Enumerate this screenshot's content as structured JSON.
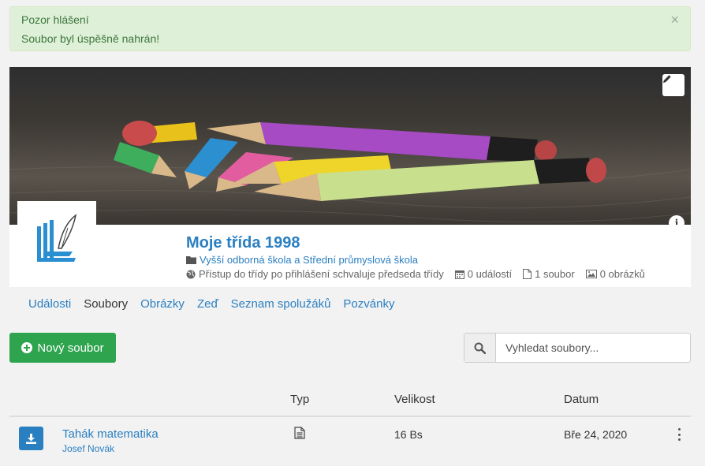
{
  "alert": {
    "title": "Pozor hlášení",
    "message": "Soubor byl úspěšně nahrán!",
    "close": "×"
  },
  "class": {
    "title": "Moje třída 1998",
    "school": "Vyšší odborná škola a Střední průmyslová škola",
    "access": "Přístup do třídy po přihlášení schvaluje předseda třídy",
    "events_count": "0 událostí",
    "files_count": "1 soubor",
    "images_count": "0 obrázků"
  },
  "tabs": [
    {
      "label": "Události",
      "active": false
    },
    {
      "label": "Soubory",
      "active": true
    },
    {
      "label": "Obrázky",
      "active": false
    },
    {
      "label": "Zeď",
      "active": false
    },
    {
      "label": "Seznam spolužáků",
      "active": false
    },
    {
      "label": "Pozvánky",
      "active": false
    }
  ],
  "toolbar": {
    "new_file_label": "Nový soubor",
    "search_placeholder": "Vyhledat soubory..."
  },
  "table": {
    "columns": {
      "type": "Typ",
      "size": "Velikost",
      "date": "Datum"
    },
    "rows": [
      {
        "name": "Tahák matematika",
        "author": "Josef Novák",
        "type_icon": "file-text-icon",
        "size": "16 Bs",
        "date": "Bře 24, 2020"
      }
    ]
  },
  "colors": {
    "link": "#2a7fc1",
    "success_button": "#2ea44f",
    "alert_bg": "#dff0d8",
    "alert_text": "#3c763d"
  }
}
